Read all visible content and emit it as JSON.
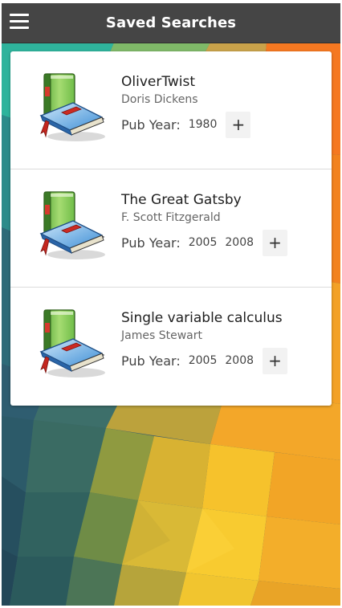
{
  "appbar": {
    "title": "Saved Searches",
    "menu_icon": "hamburger-menu-icon"
  },
  "searches": [
    {
      "title": "OliverTwist",
      "author": "Doris Dickens",
      "pub_label": "Pub Year:",
      "years": [
        "1980"
      ],
      "add_label": "+",
      "icon": "book-icon"
    },
    {
      "title": "The Great Gatsby",
      "author": "F. Scott Fitzgerald",
      "pub_label": "Pub Year:",
      "years": [
        "2005",
        "2008"
      ],
      "add_label": "+",
      "icon": "book-icon"
    },
    {
      "title": "Single variable calculus",
      "author": "James Stewart",
      "pub_label": "Pub Year:",
      "years": [
        "2005",
        "2008"
      ],
      "add_label": "+",
      "icon": "book-icon"
    }
  ],
  "colors": {
    "appbar": "#454545",
    "card": "#ffffff",
    "accent_orange": "#f47a1f",
    "accent_yellow": "#f6c32b",
    "accent_teal": "#2db5a0"
  }
}
